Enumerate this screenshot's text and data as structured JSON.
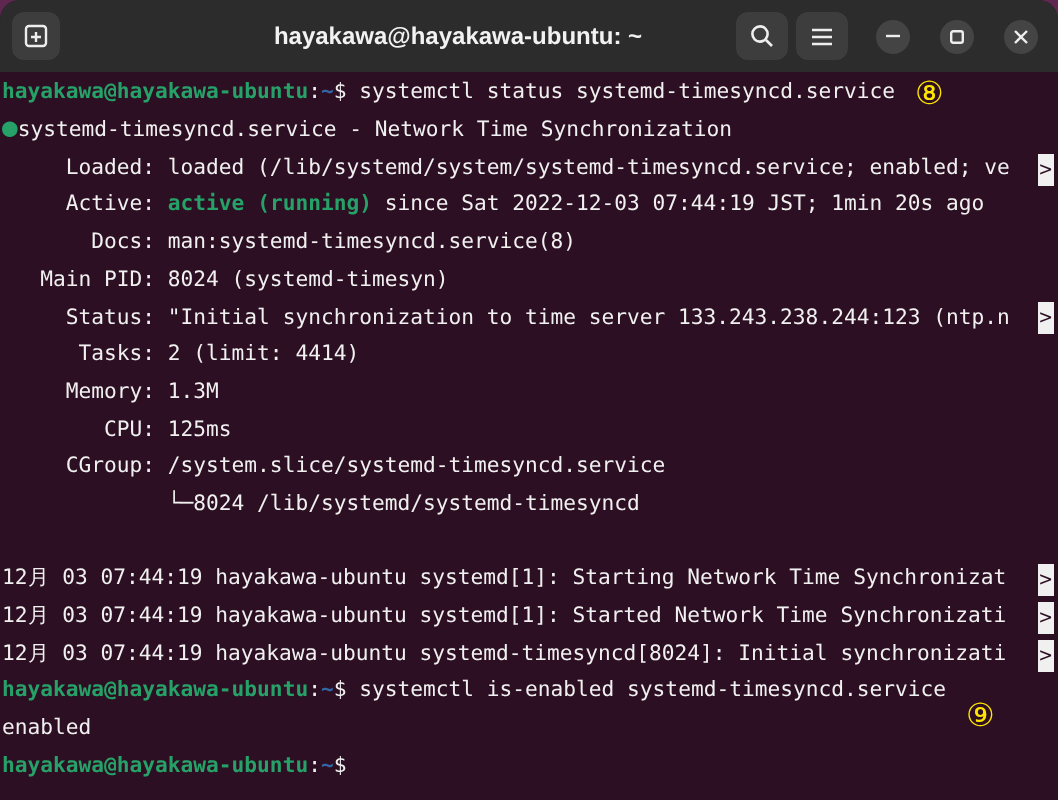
{
  "window": {
    "title": "hayakawa@hayakawa-ubuntu: ~"
  },
  "terminal": {
    "lines": [
      {
        "kind": "text",
        "segments": [
          {
            "kind": "host",
            "text": "hayakawa@hayakawa-ubuntu"
          },
          {
            "kind": "plain",
            "text": ":"
          },
          {
            "kind": "path",
            "text": "~"
          },
          {
            "kind": "plain",
            "text": "$ systemctl status systemd-timesyncd.service"
          }
        ],
        "annotation": {
          "text": "⑧",
          "kind": "inline"
        }
      },
      {
        "kind": "text",
        "segments": [
          {
            "kind": "dot",
            "text": "●"
          },
          {
            "kind": "plain",
            "text": "systemd-timesyncd.service - Network Time Synchronization"
          }
        ]
      },
      {
        "kind": "text",
        "segments": [
          {
            "kind": "plain",
            "text": "     Loaded: loaded (/lib/systemd/system/systemd-timesyncd.service; enabled; ve"
          }
        ],
        "overflow_marker": ">"
      },
      {
        "kind": "text",
        "segments": [
          {
            "kind": "plain",
            "text": "     Active: "
          },
          {
            "kind": "good",
            "text": "active (running)"
          },
          {
            "kind": "plain",
            "text": " since Sat 2022-12-03 07:44:19 JST; 1min 20s ago"
          }
        ]
      },
      {
        "kind": "text",
        "segments": [
          {
            "kind": "plain",
            "text": "       Docs: man:systemd-timesyncd.service(8)"
          }
        ]
      },
      {
        "kind": "text",
        "segments": [
          {
            "kind": "plain",
            "text": "   Main PID: 8024 (systemd-timesyn)"
          }
        ]
      },
      {
        "kind": "text",
        "segments": [
          {
            "kind": "plain",
            "text": "     Status: \"Initial synchronization to time server 133.243.238.244:123 (ntp.n"
          }
        ],
        "overflow_marker": ">"
      },
      {
        "kind": "text",
        "segments": [
          {
            "kind": "plain",
            "text": "      Tasks: 2 (limit: 4414)"
          }
        ]
      },
      {
        "kind": "text",
        "segments": [
          {
            "kind": "plain",
            "text": "     Memory: 1.3M"
          }
        ]
      },
      {
        "kind": "text",
        "segments": [
          {
            "kind": "plain",
            "text": "        CPU: 125ms"
          }
        ]
      },
      {
        "kind": "text",
        "segments": [
          {
            "kind": "plain",
            "text": "     CGroup: /system.slice/systemd-timesyncd.service"
          }
        ]
      },
      {
        "kind": "text",
        "segments": [
          {
            "kind": "plain",
            "text": "             └─8024 /lib/systemd/systemd-timesyncd"
          }
        ]
      },
      {
        "kind": "blank"
      },
      {
        "kind": "text",
        "segments": [
          {
            "kind": "plain",
            "text": "12月 03 07:44:19 hayakawa-ubuntu systemd[1]: Starting Network Time Synchronizat"
          }
        ],
        "overflow_marker": ">"
      },
      {
        "kind": "text",
        "segments": [
          {
            "kind": "plain",
            "text": "12月 03 07:44:19 hayakawa-ubuntu systemd[1]: Started Network Time Synchronizati"
          }
        ],
        "overflow_marker": ">"
      },
      {
        "kind": "text",
        "segments": [
          {
            "kind": "plain",
            "text": "12月 03 07:44:19 hayakawa-ubuntu systemd-timesyncd[8024]: Initial synchronizati"
          }
        ],
        "overflow_marker": ">"
      },
      {
        "kind": "text",
        "segments": [
          {
            "kind": "host",
            "text": "hayakawa@hayakawa-ubuntu"
          },
          {
            "kind": "plain",
            "text": ":"
          },
          {
            "kind": "path",
            "text": "~"
          },
          {
            "kind": "plain",
            "text": "$ systemctl is-enabled systemd-timesyncd.service"
          }
        ]
      },
      {
        "kind": "text",
        "segments": [
          {
            "kind": "plain",
            "text": "enabled"
          }
        ],
        "annotation": {
          "text": "⑨",
          "kind": "margin"
        }
      },
      {
        "kind": "text",
        "segments": [
          {
            "kind": "host",
            "text": "hayakawa@hayakawa-ubuntu"
          },
          {
            "kind": "plain",
            "text": ":"
          },
          {
            "kind": "path",
            "text": "~"
          },
          {
            "kind": "plain",
            "text": "$"
          }
        ]
      }
    ]
  }
}
